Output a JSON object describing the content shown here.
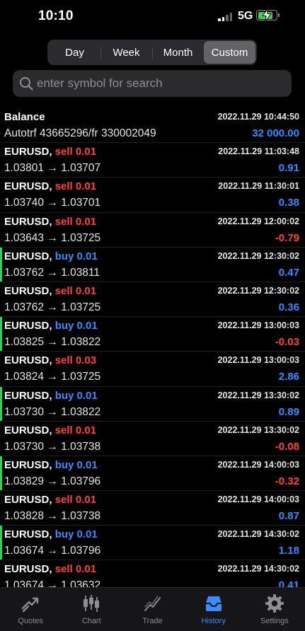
{
  "status_bar": {
    "time": "10:10",
    "network": "5G",
    "battery_level": 0.85
  },
  "period_tabs": [
    {
      "label": "Day",
      "active": false
    },
    {
      "label": "Week",
      "active": false
    },
    {
      "label": "Month",
      "active": false
    },
    {
      "label": "Custom",
      "active": true
    }
  ],
  "search": {
    "placeholder": "enter symbol for search",
    "value": ""
  },
  "balance": {
    "title": "Balance",
    "comment": "Autotrf 43665296/fr 330002049",
    "time": "2022.11.29 10:44:50",
    "amount": "32 000.00"
  },
  "deals": [
    {
      "symbol": "EURUSD,",
      "side": "sell 0.01",
      "type": "sell",
      "prices": "1.03801 → 1.03707",
      "time": "2022.11.29 11:03:48",
      "profit": "0.91"
    },
    {
      "symbol": "EURUSD,",
      "side": "sell 0.01",
      "type": "sell",
      "prices": "1.03740 → 1.03701",
      "time": "2022.11.29 11:30:01",
      "profit": "0.38"
    },
    {
      "symbol": "EURUSD,",
      "side": "sell 0.01",
      "type": "sell",
      "prices": "1.03643 → 1.03725",
      "time": "2022.11.29 12:00:02",
      "profit": "-0.79"
    },
    {
      "symbol": "EURUSD,",
      "side": "buy 0.01",
      "type": "buy",
      "prices": "1.03762 → 1.03811",
      "time": "2022.11.29 12:30:02",
      "profit": "0.47"
    },
    {
      "symbol": "EURUSD,",
      "side": "sell 0.01",
      "type": "sell",
      "prices": "1.03762 → 1.03725",
      "time": "2022.11.29 12:30:02",
      "profit": "0.36"
    },
    {
      "symbol": "EURUSD,",
      "side": "buy 0.01",
      "type": "buy",
      "prices": "1.03825 → 1.03822",
      "time": "2022.11.29 13:00:03",
      "profit": "-0.03"
    },
    {
      "symbol": "EURUSD,",
      "side": "sell 0.03",
      "type": "sell",
      "prices": "1.03824 → 1.03725",
      "time": "2022.11.29 13:00:03",
      "profit": "2.86"
    },
    {
      "symbol": "EURUSD,",
      "side": "buy 0.01",
      "type": "buy",
      "prices": "1.03730 → 1.03822",
      "time": "2022.11.29 13:30:02",
      "profit": "0.89"
    },
    {
      "symbol": "EURUSD,",
      "side": "sell 0.01",
      "type": "sell",
      "prices": "1.03730 → 1.03738",
      "time": "2022.11.29 13:30:02",
      "profit": "-0.08"
    },
    {
      "symbol": "EURUSD,",
      "side": "buy 0.01",
      "type": "buy",
      "prices": "1.03829 → 1.03796",
      "time": "2022.11.29 14:00:03",
      "profit": "-0.32"
    },
    {
      "symbol": "EURUSD,",
      "side": "sell 0.01",
      "type": "sell",
      "prices": "1.03828 → 1.03738",
      "time": "2022.11.29 14:00:03",
      "profit": "0.87"
    },
    {
      "symbol": "EURUSD,",
      "side": "buy 0.01",
      "type": "buy",
      "prices": "1.03674 → 1.03796",
      "time": "2022.11.29 14:30:02",
      "profit": "1.18"
    },
    {
      "symbol": "EURUSD,",
      "side": "sell 0.01",
      "type": "sell",
      "prices": "1.03674 → 1.03632",
      "time": "2022.11.29 14:30:02",
      "profit": "0.41"
    }
  ],
  "colors": {
    "sell": "#ff453a",
    "buy": "#3a8cff",
    "profit_positive": "#3a8cff",
    "profit_negative": "#ff453a",
    "buy_accent": "#30d158",
    "sell_accent": "#ff453a",
    "tab_active": "#3a8cff",
    "tab_inactive": "#8e8e93"
  },
  "tab_bar": [
    {
      "label": "Quotes",
      "icon": "quotes-icon",
      "active": false
    },
    {
      "label": "Chart",
      "icon": "chart-icon",
      "active": false
    },
    {
      "label": "Trade",
      "icon": "trade-icon",
      "active": false
    },
    {
      "label": "History",
      "icon": "history-icon",
      "active": true
    },
    {
      "label": "Settings",
      "icon": "gear-icon",
      "active": false
    }
  ]
}
